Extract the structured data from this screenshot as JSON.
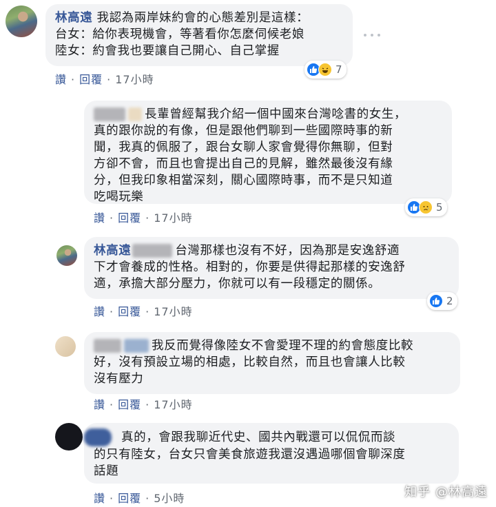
{
  "comments": [
    {
      "author": "林高遠",
      "lines": [
        "我認為兩岸妹約會的心態差別是這樣：",
        "台女：給你表現機會，等著看你怎麼伺候老娘",
        "陸女：約會我也要讓自己開心、自己掌握"
      ],
      "like_label": "讚",
      "reply_label": "回覆",
      "time": "17小時",
      "reaction_count": "7"
    },
    {
      "lines": [
        "長輩曾經幫我介紹一個中國來台灣唸書的女生，",
        "真的跟你說的有像，但是跟他們聊到一些國際時事的新",
        "聞，我真的佩服了，跟台女聊人家會覺得你無聊，但對",
        "方卻不會，而且也會提出自己的見解，雖然最後沒有緣",
        "分，但我印象相當深刻，關心國際時事，而不是只知道",
        "吃喝玩樂"
      ],
      "like_label": "讚",
      "reply_label": "回覆",
      "time": "17小時",
      "reaction_count": "5"
    },
    {
      "author": "林高遠",
      "lines": [
        "台灣那樣也沒有不好，因為那是安逸舒適",
        "下才會養成的性格。相對的，你要是供得起那樣的安逸舒",
        "適，承擔大部分壓力，你就可以有一段穩定的關係。"
      ],
      "like_label": "讚",
      "reply_label": "回覆",
      "time": "17小時",
      "reaction_count": "2"
    },
    {
      "lines": [
        "我反而覺得像陸女不會愛理不理的約會態度比較",
        "好，沒有預設立場的相處，比較自然，而且也會讓人比較",
        "沒有壓力"
      ],
      "like_label": "讚",
      "reply_label": "回覆",
      "time": "17小時"
    },
    {
      "lines": [
        "真的，會跟我聊近代史、國共內戰還可以侃侃而談",
        "的只有陸女，台女只會美食旅遊我還沒遇過哪個會聊深度",
        "話題"
      ],
      "like_label": "讚",
      "reply_label": "回覆",
      "time": "5小時"
    }
  ],
  "watermark": "知乎 @林高遠",
  "icons": {
    "more": "more-options-icon",
    "like": "like-reaction-icon",
    "laugh": "haha-reaction-icon",
    "sad": "sad-reaction-icon"
  }
}
